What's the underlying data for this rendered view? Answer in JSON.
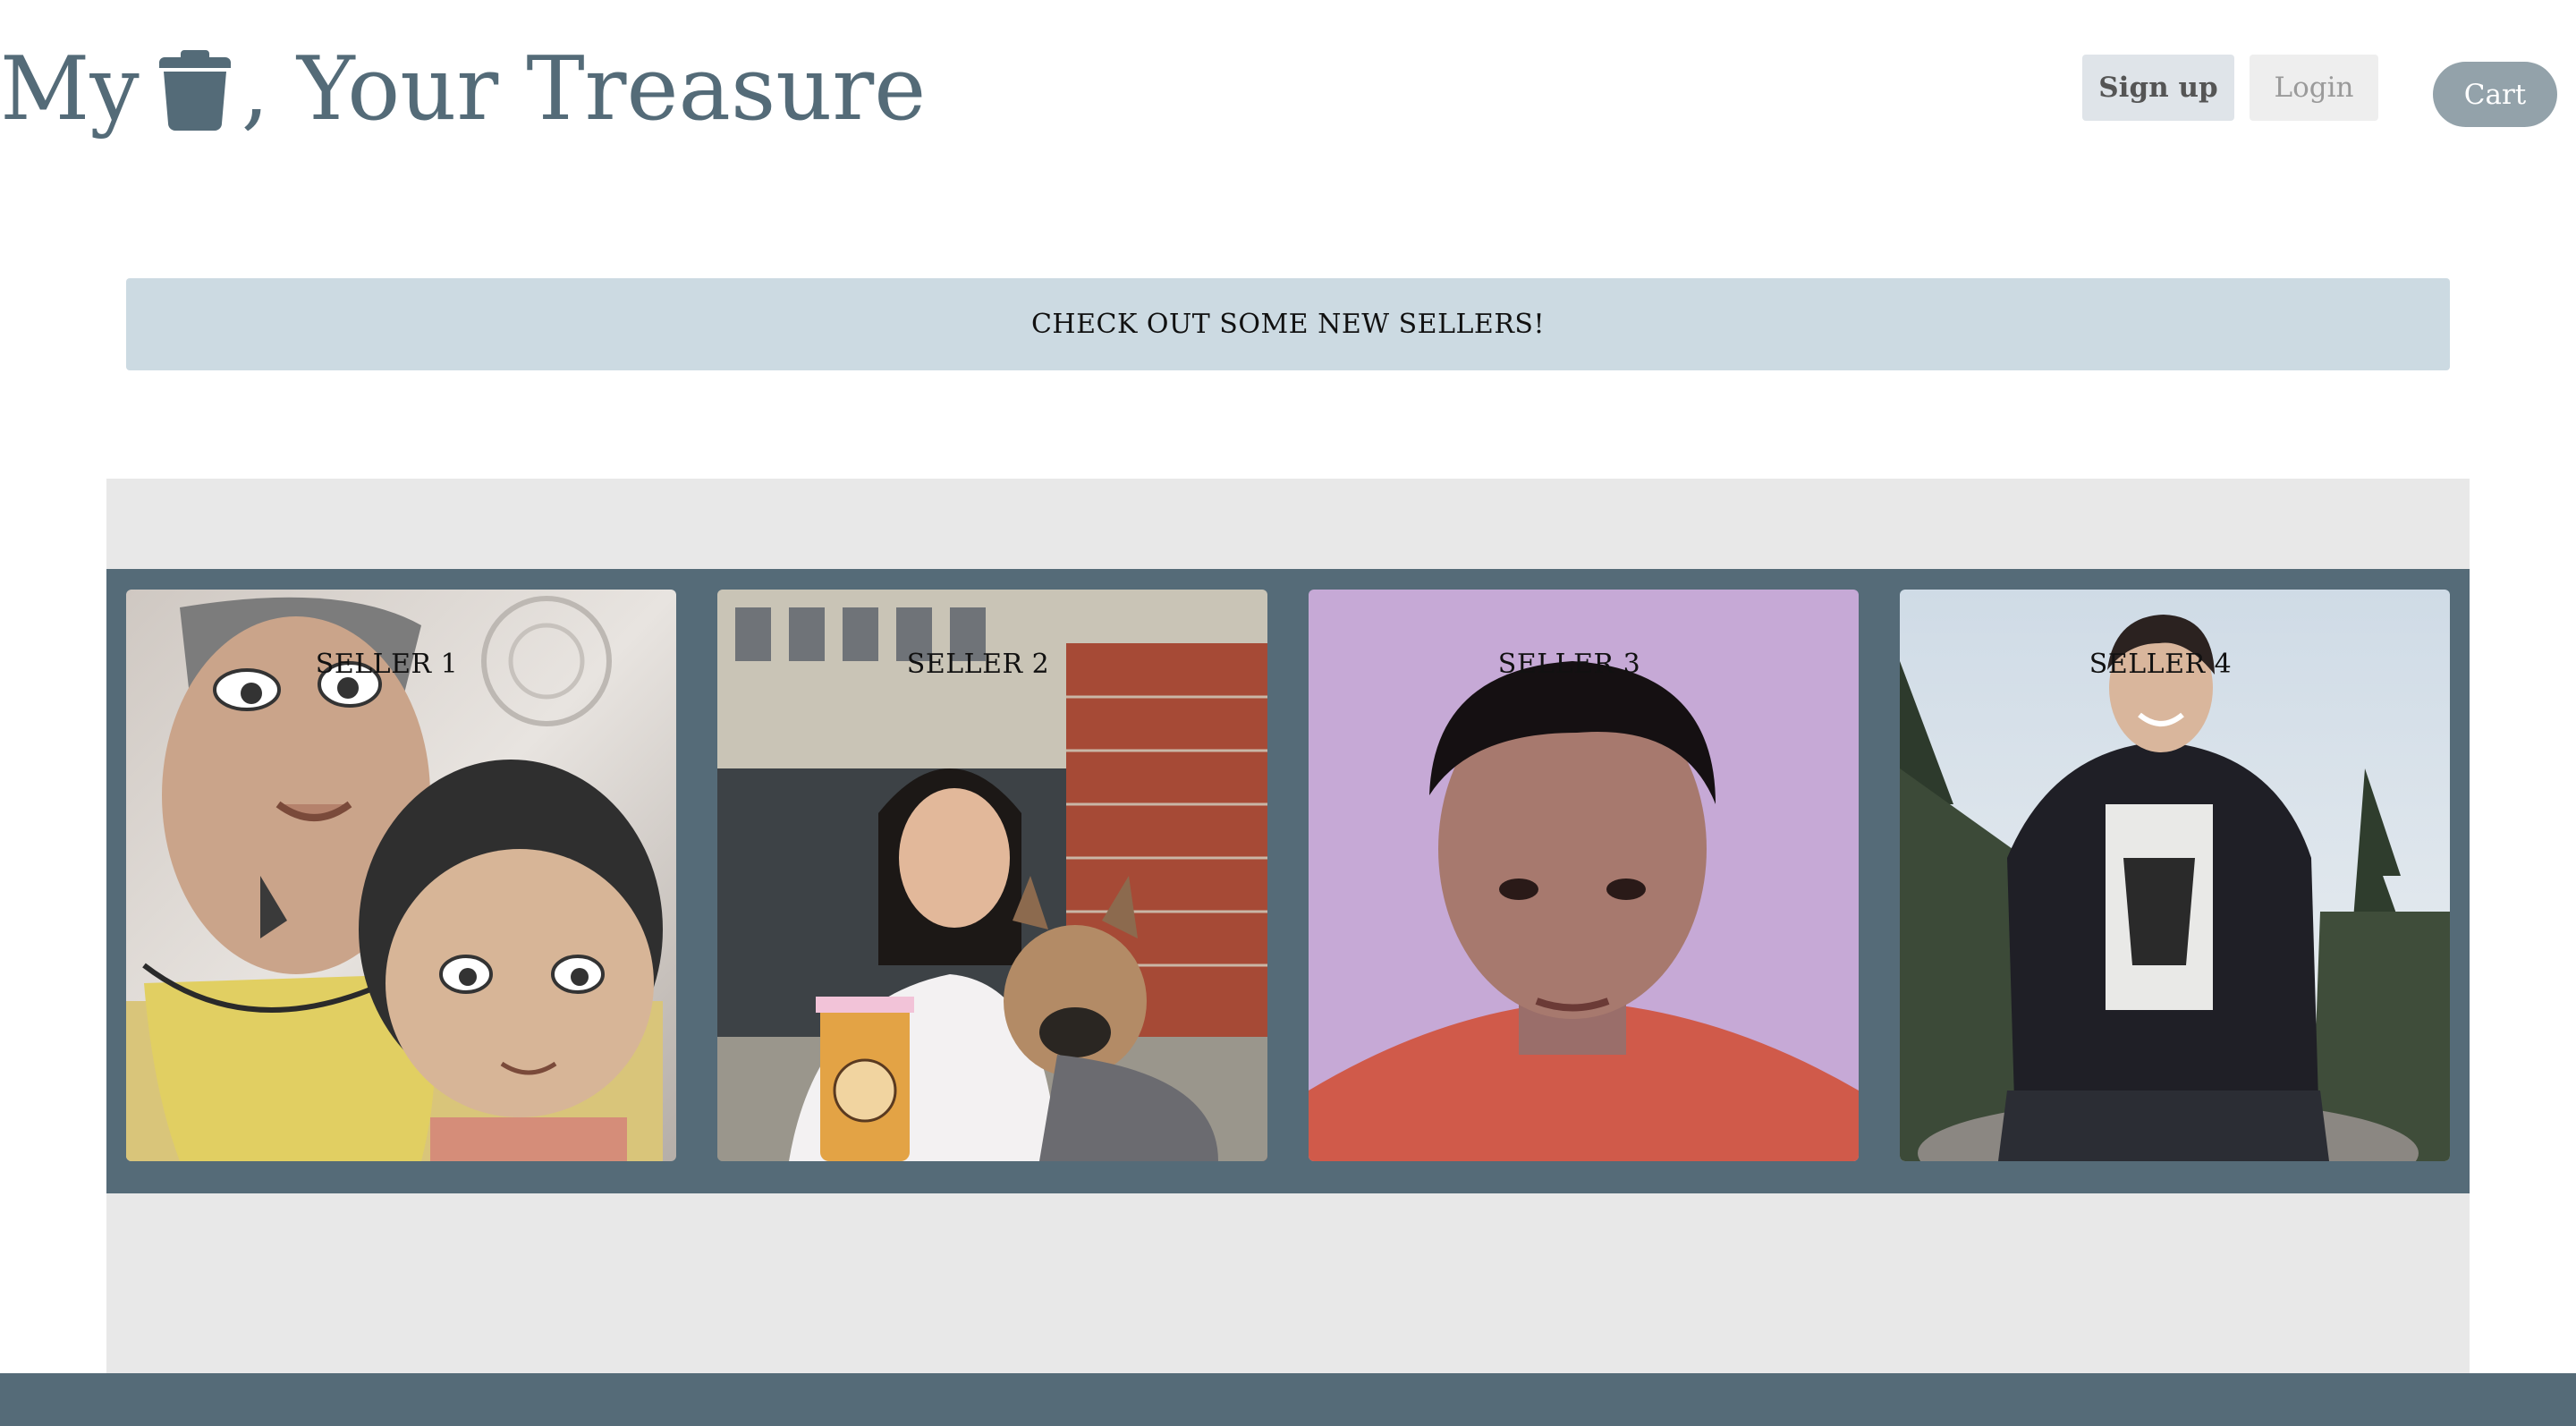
{
  "header": {
    "title_before": "My",
    "title_icon": "trash-icon",
    "title_after": ", Your Treasure",
    "signup_label": "Sign up",
    "login_label": "Login",
    "cart_label": "Cart"
  },
  "banner": {
    "text": "CHECK OUT SOME NEW SELLERS!"
  },
  "sellers": [
    {
      "label": "SELLER 1"
    },
    {
      "label": "SELLER 2"
    },
    {
      "label": "SELLER 3"
    },
    {
      "label": "SELLER 4"
    }
  ],
  "colors": {
    "brand": "#546b78",
    "banner_bg": "#ccdae2",
    "strip_bg": "#556b78",
    "carousel_bg": "#e8e8e8",
    "cart_bg": "#93a2aa"
  }
}
